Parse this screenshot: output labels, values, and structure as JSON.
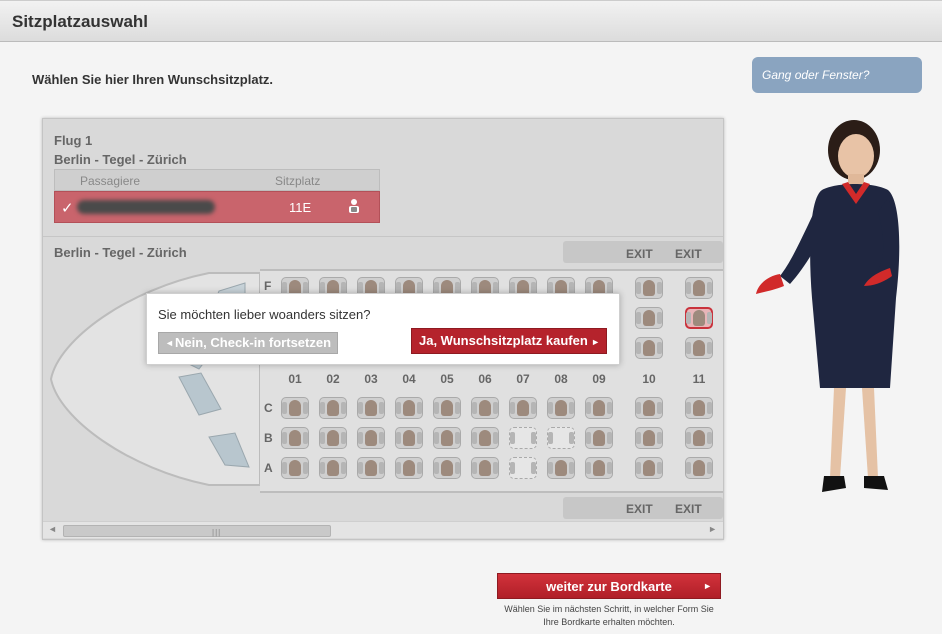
{
  "page": {
    "title": "Sitzplatzauswahl",
    "intro": "Wählen Sie hier Ihren Wunschsitzplatz.",
    "help_bubble": "Gang oder Fenster?"
  },
  "flight": {
    "label": "Flug 1",
    "route": "Berlin - Tegel - Zürich",
    "table": {
      "col_passengers": "Passagiere",
      "col_seat": "Sitzplatz",
      "passenger_seat": "11E"
    },
    "map_route": "Berlin - Tegel - Zürich",
    "exit_label": "EXIT",
    "row_letters": [
      "F",
      "C",
      "B",
      "A"
    ],
    "columns": [
      "01",
      "02",
      "03",
      "04",
      "05",
      "06",
      "07",
      "08",
      "09",
      "10",
      "11"
    ]
  },
  "modal": {
    "question": "Sie möchten lieber woanders sitzen?",
    "decline": "Nein, Check-in fortsetzen",
    "accept": "Ja, Wunschsitzplatz kaufen"
  },
  "footer": {
    "next_button": "weiter zur Bordkarte",
    "next_hint": "Wählen Sie im nächsten Schritt, in welcher Form Sie Ihre Bordkarte erhalten möchten."
  },
  "colors": {
    "accent_red": "#b5232c",
    "bubble_blue": "#8aa4c0",
    "selected_row": "#c9646c"
  }
}
